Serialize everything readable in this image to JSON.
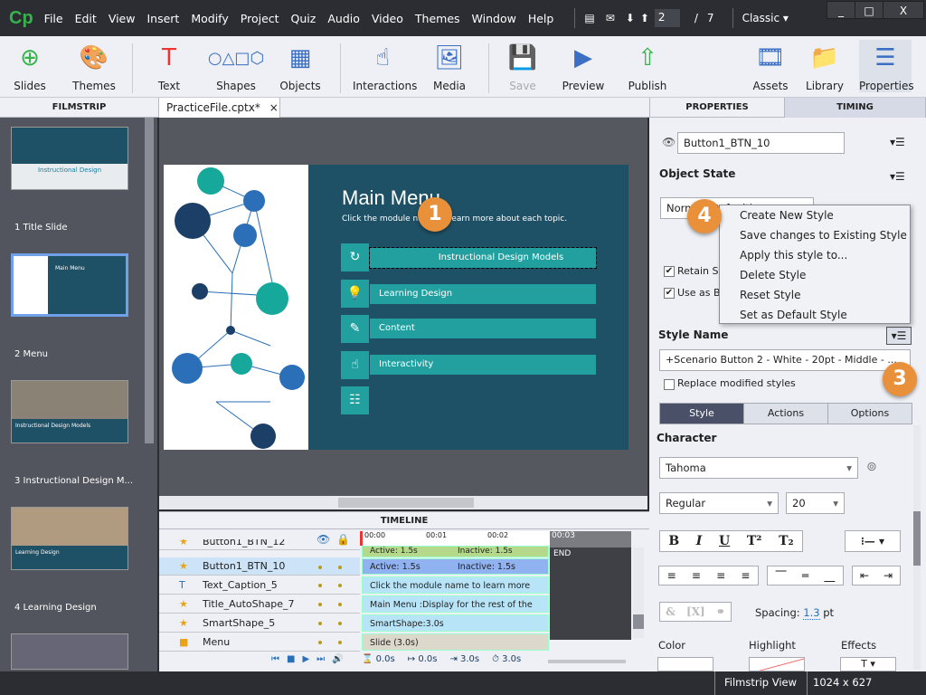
{
  "app": {
    "logo": "Cp",
    "menu": [
      "File",
      "Edit",
      "View",
      "Insert",
      "Modify",
      "Project",
      "Quiz",
      "Audio",
      "Video",
      "Themes",
      "Window",
      "Help"
    ],
    "page_current": "2",
    "page_sep": "/",
    "page_total": "7",
    "workspace": "Classic",
    "win_min": "_",
    "win_max": "□",
    "win_close": "X"
  },
  "toolbar": [
    {
      "label": "Slides",
      "icon": "plus-circle-icon"
    },
    {
      "label": "Themes",
      "icon": "palette-icon"
    },
    {
      "label": "Text",
      "icon": "text-icon"
    },
    {
      "label": "Shapes",
      "icon": "shapes-icon"
    },
    {
      "label": "Objects",
      "icon": "objects-icon"
    },
    {
      "label": "Interactions",
      "icon": "hand-pointer-icon"
    },
    {
      "label": "Media",
      "icon": "image-icon"
    },
    {
      "label": "Save",
      "icon": "floppy-icon"
    },
    {
      "label": "Preview",
      "icon": "play-icon"
    },
    {
      "label": "Publish",
      "icon": "publish-icon"
    },
    {
      "label": "Assets",
      "icon": "assets-icon"
    },
    {
      "label": "Library",
      "icon": "folder-icon"
    },
    {
      "label": "Properties",
      "icon": "properties-icon"
    }
  ],
  "tabs": {
    "filmstrip": "FILMSTRIP",
    "file": "PracticeFile.cptx*",
    "close": "×",
    "properties": "PROPERTIES",
    "timing": "TIMING"
  },
  "filmstrip": [
    {
      "label": "1 Title Slide",
      "thumb_text": "Instructional Design"
    },
    {
      "label": "2 Menu",
      "thumb_text": "Main Menu"
    },
    {
      "label": "3 Instructional Design M...",
      "thumb_text": "Instructional Design Models"
    },
    {
      "label": "4 Learning Design",
      "thumb_text": "Learning Design"
    }
  ],
  "slide": {
    "title": "Main Menu",
    "subtitle": "Click the module name to learn more about each topic.",
    "buttons": [
      "Instructional Design Models",
      "Learning Design",
      "Content",
      "Interactivity"
    ],
    "callout1": "1"
  },
  "timeline": {
    "title": "TIMELINE",
    "ticks": [
      "00:00",
      "00:01",
      "00:02",
      "00:03"
    ],
    "end": "END",
    "rows": [
      {
        "name": "Button1_BTN_12",
        "bar": "Active: 1.5s",
        "bar2": "Inactive: 1.5s"
      },
      {
        "name": "Button1_BTN_10",
        "bar": "Active: 1.5s",
        "bar2": "Inactive: 1.5s"
      },
      {
        "name": "Text_Caption_5",
        "bar": "Click the module name to learn more about..."
      },
      {
        "name": "Title_AutoShape_7",
        "bar": "Main Menu :Display for the rest of the slide"
      },
      {
        "name": "SmartShape_5",
        "bar": "SmartShape:3.0s"
      },
      {
        "name": "Menu",
        "bar": "Slide (3.0s)"
      }
    ],
    "footer": [
      "0.0s",
      "0.0s",
      "3.0s",
      "3.0s"
    ]
  },
  "properties": {
    "object_name": "Button1_BTN_10",
    "object_state": "Object State",
    "state_value": "Normal (Default)",
    "retain": "Retain St",
    "use_as": "Use as B",
    "style_name_label": "Style Name",
    "style_value": "+Scenario Button 2 - White -  20pt - Middle - ...",
    "replace": "Replace modified styles",
    "subtabs": [
      "Style",
      "Actions",
      "Options"
    ],
    "character": "Character",
    "font": "Tahoma",
    "font_style": "Regular",
    "font_size": "20",
    "format_buttons": [
      "B",
      "I",
      "U",
      "T²",
      "T₂"
    ],
    "spacing_label": "Spacing:",
    "spacing_value": "1.3",
    "spacing_unit": "pt",
    "color": "Color",
    "highlight": "Highlight",
    "effects": "Effects",
    "callout3": "3",
    "callout4": "4"
  },
  "context_menu": [
    "Create New Style",
    "Save changes to Existing Style",
    "Apply this style to...",
    "Delete Style",
    "Reset Style",
    "Set as Default Style"
  ],
  "status": {
    "view": "Filmstrip View",
    "size": "1024 x 627"
  }
}
